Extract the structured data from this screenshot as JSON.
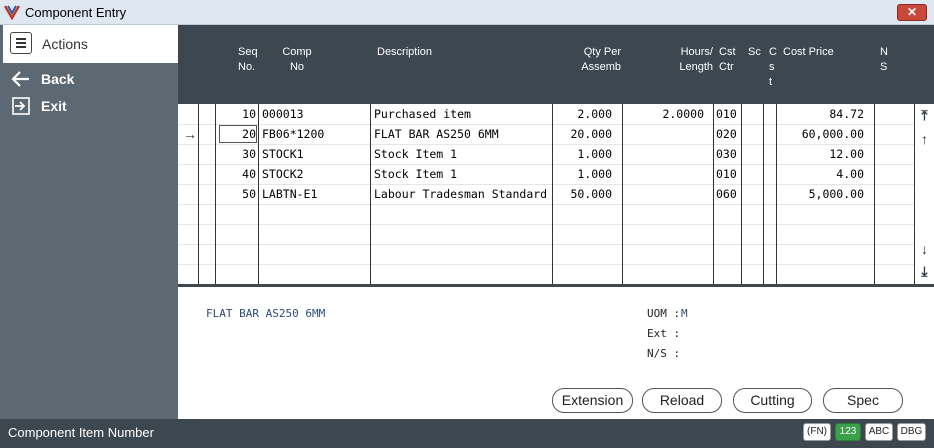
{
  "window": {
    "title": "Component Entry",
    "close_glyph": "✕"
  },
  "sidebar": {
    "header": "Actions",
    "items": [
      {
        "label": "Back",
        "icon": "arrow-left-icon"
      },
      {
        "label": "Exit",
        "icon": "exit-icon"
      }
    ]
  },
  "grid": {
    "columns": [
      {
        "l1": "Seq",
        "l2": "No."
      },
      {
        "l1": "Comp",
        "l2": "No"
      },
      {
        "l1": "Description",
        "l2": ""
      },
      {
        "l1": "Qty Per",
        "l2": "Assemb"
      },
      {
        "l1": "Hours/",
        "l2": "Length"
      },
      {
        "l1": "Cst",
        "l2": "Ctr"
      },
      {
        "l1": "Sc",
        "l2": ""
      },
      {
        "l1": "C",
        "l2": "s",
        "l3": "t"
      },
      {
        "l1": "Cost Price",
        "l2": ""
      },
      {
        "l1": "N",
        "l2": "S"
      }
    ],
    "rows": [
      {
        "seq": "10",
        "comp": "000013",
        "desc": "Purchased item",
        "qty": "2.000",
        "hours": "2.0000",
        "cst": "010",
        "price": "84.72"
      },
      {
        "seq": "20",
        "comp": "FB06*1200",
        "desc": "FLAT BAR AS250 6MM",
        "qty": "20.000",
        "hours": "",
        "cst": "020",
        "price": "60,000.00"
      },
      {
        "seq": "30",
        "comp": "STOCK1",
        "desc": "Stock Item 1",
        "qty": "1.000",
        "hours": "",
        "cst": "030",
        "price": "12.00"
      },
      {
        "seq": "40",
        "comp": "STOCK2",
        "desc": "Stock Item 1",
        "qty": "1.000",
        "hours": "",
        "cst": "010",
        "price": "4.00"
      },
      {
        "seq": "50",
        "comp": "LABTN-E1",
        "desc": "Labour Tradesman Standard",
        "qty": "50.000",
        "hours": "",
        "cst": "060",
        "price": "5,000.00"
      }
    ],
    "current_row_pointer": "→",
    "scroll": {
      "top": "⤒",
      "up": "↑",
      "down": "↓",
      "bottom": "⤓"
    }
  },
  "detail": {
    "description": "FLAT BAR AS250 6MM",
    "uom_label": "UOM :",
    "uom_value": "M",
    "ext_label": "Ext :",
    "ns_label": "N/S :"
  },
  "buttons": {
    "extension": "Extension",
    "reload": "Reload",
    "cutting": "Cutting",
    "spec": "Spec"
  },
  "status": {
    "text": "Component Item Number",
    "badges": [
      "(FN)",
      "123",
      "ABC",
      "DBG"
    ]
  },
  "colors": {
    "header_bg": "#3c4750",
    "sidebar_bg": "#5c6973",
    "detail_text": "#2f4a7a",
    "badge_active": "#3aa14a"
  }
}
